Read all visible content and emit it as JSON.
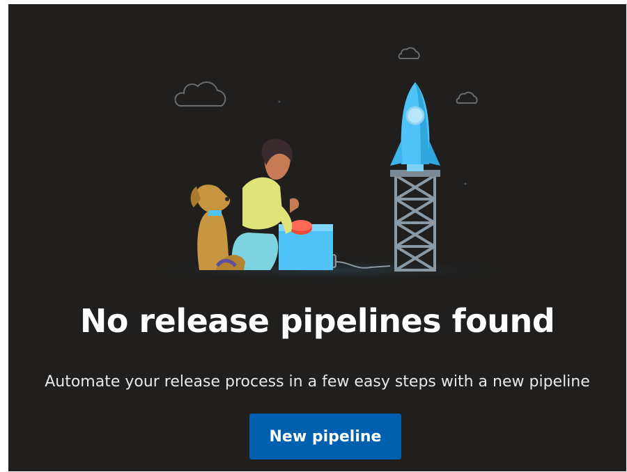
{
  "empty_state": {
    "title": "No release pipelines found",
    "description": "Automate your release process in a few easy steps with a new pipeline",
    "new_pipeline_label": "New pipeline"
  },
  "colors": {
    "background": "#201f1e",
    "button": "#0060b0",
    "rocket": "#4fc3f7",
    "dog": "#c89640"
  },
  "illustration": {
    "icons": [
      "cloud-icon",
      "rocket-icon",
      "launch-tower-icon",
      "dog-icon",
      "person-icon",
      "launch-button-icon"
    ]
  }
}
